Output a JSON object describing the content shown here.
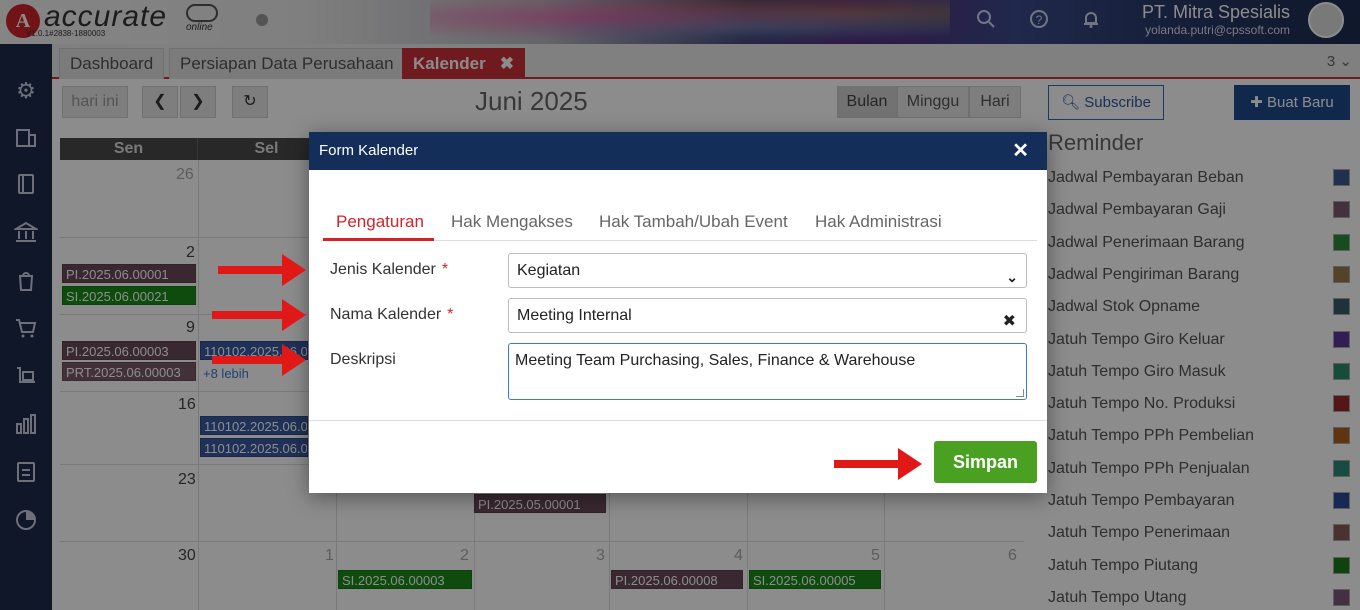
{
  "app": {
    "brand": "accurate",
    "online": "online",
    "version": "V1.0.1#2838-1880003",
    "logo_letter": "A"
  },
  "header": {
    "company": "PT. Mitra Spesialis",
    "email": "yolanda.putri@cpssoft.com",
    "icons": [
      "search-icon",
      "help-icon",
      "bell-icon"
    ]
  },
  "sidebar": {
    "icons": [
      "settings-icon",
      "company-icon",
      "ledger-icon",
      "bank-icon",
      "sales-icon",
      "cart-icon",
      "inventory-icon",
      "reports-icon",
      "tax-icon",
      "dashboard-icon"
    ]
  },
  "tabs": [
    {
      "label": "Dashboard"
    },
    {
      "label": "Persiapan Data Perusahaan"
    },
    {
      "label": "Kalender",
      "close": "✖"
    }
  ],
  "tab_count": "3 ⌄",
  "calendar": {
    "today": "hari ini",
    "prev": "❮",
    "next": "❯",
    "refresh": "↻",
    "title": "Juni 2025",
    "views": [
      "Bulan",
      "Minggu",
      "Hari"
    ],
    "days": [
      "Sen",
      "Sel"
    ],
    "dates": [
      "26",
      "2",
      "9",
      "16",
      "23",
      "30",
      "1",
      "2",
      "3",
      "4",
      "5",
      "6"
    ],
    "events": {
      "e1": "PI.2025.06.00001",
      "e2": "SI.2025.06.00021",
      "e3": "PI.2025.06.00003",
      "e4": "PRT.2025.06.00003",
      "e5": "110102.2025.06.0",
      "e6": "110102.2025.06.0",
      "e7": "110102.2025.06.0",
      "more": "+8 lebih",
      "e8": "PI.2025.05.00001",
      "e9": "SI.2025.06.00003",
      "e10": "PI.2025.06.00008",
      "e11": "SI.2025.06.00005"
    }
  },
  "right": {
    "subscribe": "Subscribe",
    "buat_baru": "Buat Baru",
    "reminder_title": "Reminder",
    "reminders": [
      {
        "label": "Jadwal Pembayaran Beban",
        "color": "#3a5a90"
      },
      {
        "label": "Jadwal Pembayaran Gaji",
        "color": "#7a5a70"
      },
      {
        "label": "Jadwal Penerimaan Barang",
        "color": "#2a8a3a"
      },
      {
        "label": "Jadwal Pengiriman Barang",
        "color": "#9a7a4a"
      },
      {
        "label": "Jadwal Stok Opname",
        "color": "#3a5a6a"
      },
      {
        "label": "Jatuh Tempo Giro Keluar",
        "color": "#5a3a9a"
      },
      {
        "label": "Jatuh Tempo Giro Masuk",
        "color": "#2a8a6a"
      },
      {
        "label": "Jatuh Tempo No. Produksi",
        "color": "#9a2a2a"
      },
      {
        "label": "Jatuh Tempo PPh Pembelian",
        "color": "#b06020"
      },
      {
        "label": "Jatuh Tempo PPh Penjualan",
        "color": "#2a8a7a"
      },
      {
        "label": "Jatuh Tempo Pembayaran",
        "color": "#2a4a9a"
      },
      {
        "label": "Jatuh Tempo Penerimaan",
        "color": "#8a5a5a"
      },
      {
        "label": "Jatuh Tempo Piutang",
        "color": "#1a7a1a"
      },
      {
        "label": "Jatuh Tempo Utang",
        "color": "#7a5a7a"
      }
    ]
  },
  "modal": {
    "title": "Form Kalender",
    "close": "✕",
    "tabs": [
      "Pengaturan",
      "Hak Mengakses",
      "Hak Tambah/Ubah Event",
      "Hak Administrasi"
    ],
    "fields": {
      "jenis_label": "Jenis Kalender",
      "jenis_value": "Kegiatan",
      "nama_label": "Nama Kalender",
      "nama_value": "Meeting Internal",
      "desk_label": "Deskripsi",
      "desk_value": "Meeting Team Purchasing, Sales, Finance & Warehouse",
      "required": "*"
    },
    "save": "Simpan"
  }
}
